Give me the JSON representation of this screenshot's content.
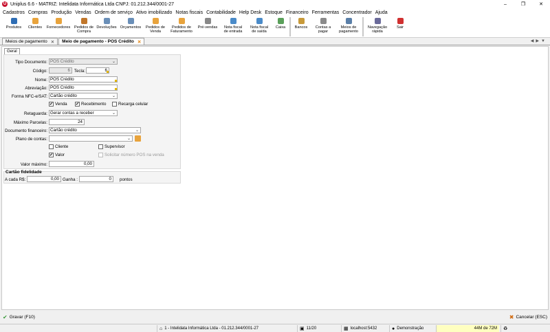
{
  "window": {
    "title": "Uniplus 6.6 - MATRIZ: Intelidata Informática Ltda CNPJ: 01.212.344/0001-27",
    "icon_letter": "U"
  },
  "menu": [
    "Cadastros",
    "Compras",
    "Produção",
    "Vendas",
    "Ordem de serviço",
    "Ativo imobilizado",
    "Notas fiscais",
    "Contabilidade",
    "Help Desk",
    "Estoque",
    "Financeiro",
    "Ferramentas",
    "Concentrador",
    "Ajuda"
  ],
  "toolbar": [
    {
      "label": "Produtos",
      "icon": "box-icon",
      "color": "#2e6db4"
    },
    {
      "label": "Clientes",
      "icon": "person-icon",
      "color": "#e8a33c"
    },
    {
      "label": "Fornecedores",
      "icon": "supplier-icon",
      "color": "#e8a33c"
    },
    {
      "label": "Pedidos de\nCompra",
      "icon": "cart-icon",
      "color": "#c0762b"
    },
    {
      "label": "Devoluções",
      "icon": "return-icon",
      "color": "#6a8fb8"
    },
    {
      "label": "Orçamentos",
      "icon": "quote-icon",
      "color": "#6a8fb8"
    },
    {
      "label": "Pedidos de\nVenda",
      "icon": "order-icon",
      "color": "#e8a33c"
    },
    {
      "label": "Pedidos de\nFaturamento",
      "icon": "billing-icon",
      "color": "#e8a33c"
    },
    {
      "label": "Pré-vendas",
      "icon": "presale-icon",
      "color": "#888888"
    },
    {
      "label": "Nota fiscal\nde entrada",
      "icon": "invoice-in-icon",
      "color": "#4a8bc9"
    },
    {
      "label": "Nota fiscal\nde saída",
      "icon": "invoice-out-icon",
      "color": "#4a8bc9"
    },
    {
      "label": "Caixa",
      "icon": "cashbox-icon",
      "color": "#5aa05a"
    },
    {
      "label": "Bancos",
      "icon": "bank-icon",
      "color": "#c89a3a"
    },
    {
      "label": "Contas a\npagar",
      "icon": "payable-icon",
      "color": "#8a8a8a"
    },
    {
      "label": "Meios de\npagamento",
      "icon": "payment-icon",
      "color": "#5a7fa8"
    },
    {
      "label": "Navegação\nrápida",
      "icon": "navigation-icon",
      "color": "#6a6a9a"
    },
    {
      "label": "Sair",
      "icon": "power-icon",
      "color": "#d03030"
    }
  ],
  "tabs": [
    {
      "label": "Meios de pagamento",
      "active": false
    },
    {
      "label": "Meio de pagamento - POS Crédito",
      "active": true
    }
  ],
  "subtab": "Geral",
  "form": {
    "tipo_documento": {
      "label": "Tipo Documento:",
      "value": "POS Crédito"
    },
    "codigo": {
      "label": "Código:",
      "value": "6"
    },
    "tecla": {
      "label": "Tecla:",
      "value": "6"
    },
    "nome": {
      "label": "Nome:",
      "value": "POS Crédito"
    },
    "abreviacao": {
      "label": "Abreviação:",
      "value": "POS Crédito"
    },
    "forma_nfce": {
      "label": "Forma NFC-e/SAT:",
      "value": "Cartão crédito"
    },
    "venda": {
      "label": "Venda",
      "checked": true
    },
    "recebimento": {
      "label": "Recebimento",
      "checked": true
    },
    "recarga": {
      "label": "Recarga celular",
      "checked": false
    },
    "retaguarda": {
      "label": "Retaguarda:",
      "value": "Gerar contas a receber"
    },
    "max_parcelas": {
      "label": "Máximo Parcelas:",
      "value": "24"
    },
    "doc_financeiro": {
      "label": "Documento financeiro:",
      "value": "Cartão crédito"
    },
    "plano_contas": {
      "label": "Plano de contas:",
      "value": ""
    },
    "cliente": {
      "label": "Cliente",
      "checked": false
    },
    "supervisor": {
      "label": "Supervisor",
      "checked": false
    },
    "valor": {
      "label": "Valor",
      "checked": true
    },
    "solicitar_pos": {
      "label": "Solicitar número POS na venda",
      "checked": false
    },
    "valor_maximo": {
      "label": "Valor máximo:",
      "value": "0,00"
    }
  },
  "fidelidade": {
    "title": "Cartão fidelidade",
    "a_cada_label": "A cada R$:",
    "a_cada_value": "0,00",
    "ganha_label": "Ganha :",
    "ganha_value": "0",
    "pontos_label": "pontos"
  },
  "bottom": {
    "save_label": "Gravar (F10)",
    "cancel_label": "Cancelar (ESC)"
  },
  "status": {
    "company": "1 - Intelidata Informática Ltda - 01.212.344/0001-27",
    "page": "11/20",
    "server": "localhost:5432",
    "user": "Demonstração",
    "memory": "44M de 72M"
  }
}
